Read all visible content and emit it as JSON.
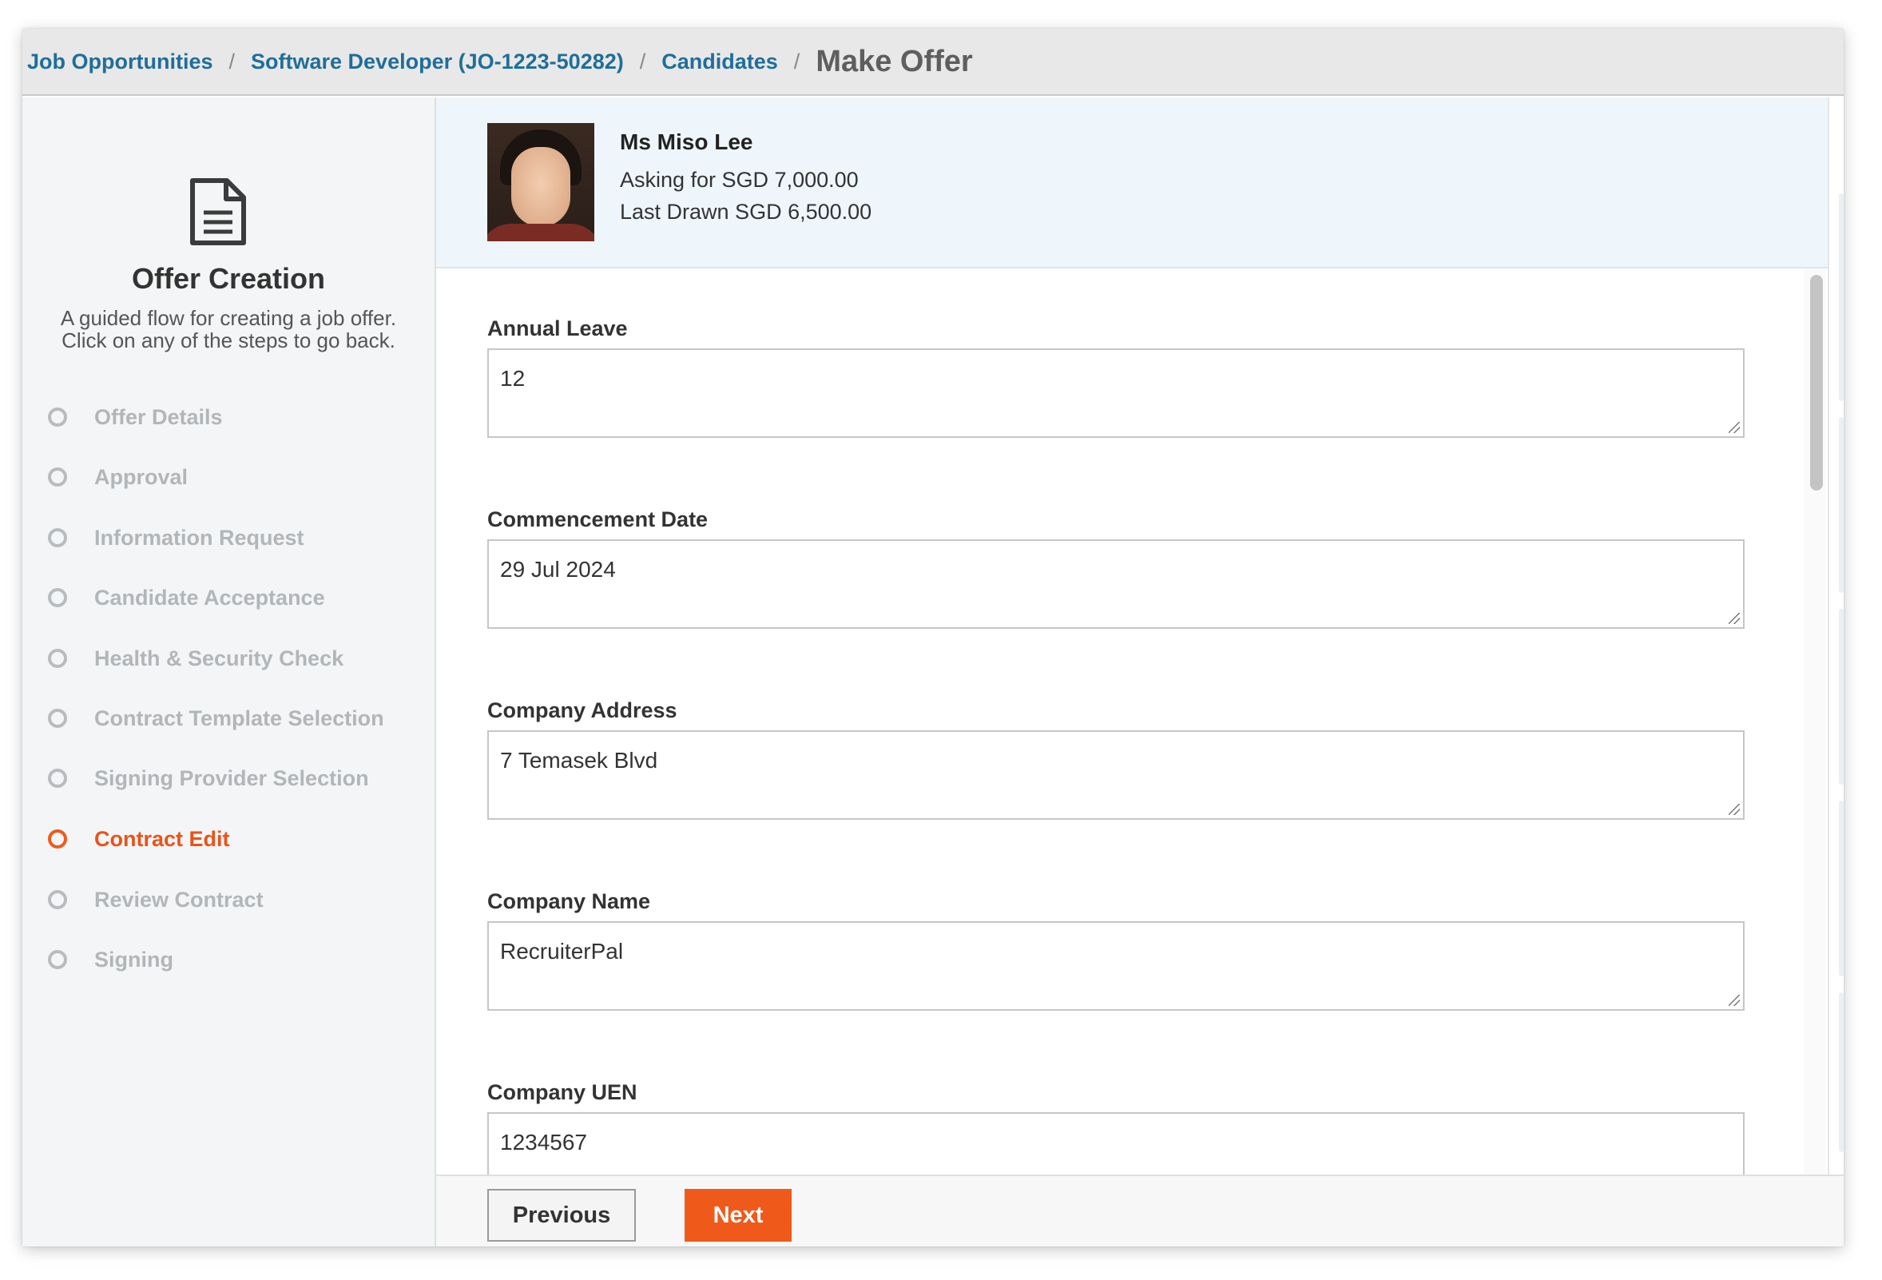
{
  "breadcrumb": {
    "items": [
      "Job Opportunities",
      "Software Developer (JO-1223-50282)",
      "Candidates"
    ],
    "current": "Make Offer",
    "separator": "/"
  },
  "sidebar": {
    "icon": "document-icon",
    "title": "Offer Creation",
    "description": "A guided flow for creating a job offer. Click on any of the steps to go back.",
    "steps": [
      {
        "label": "Offer Details",
        "state": "inactive"
      },
      {
        "label": "Approval",
        "state": "inactive"
      },
      {
        "label": "Information Request",
        "state": "inactive"
      },
      {
        "label": "Candidate Acceptance",
        "state": "inactive"
      },
      {
        "label": "Health & Security Check",
        "state": "inactive"
      },
      {
        "label": "Contract Template Selection",
        "state": "inactive"
      },
      {
        "label": "Signing Provider Selection",
        "state": "inactive"
      },
      {
        "label": "Contract Edit",
        "state": "active"
      },
      {
        "label": "Review Contract",
        "state": "inactive"
      },
      {
        "label": "Signing",
        "state": "inactive"
      }
    ]
  },
  "candidate": {
    "name": "Ms Miso Lee",
    "asking": "Asking for SGD 7,000.00",
    "last_drawn": "Last Drawn SGD 6,500.00"
  },
  "form": {
    "fields": [
      {
        "label": "Annual Leave",
        "value": "12"
      },
      {
        "label": "Commencement Date",
        "value": "29 Jul 2024"
      },
      {
        "label": "Company Address",
        "value": "7 Temasek Blvd"
      },
      {
        "label": "Company Name",
        "value": "RecruiterPal"
      },
      {
        "label": "Company UEN",
        "value": "1234567"
      }
    ]
  },
  "footer": {
    "previous_label": "Previous",
    "next_label": "Next"
  },
  "colors": {
    "accent": "#ef5a1b",
    "link": "#1f6e99",
    "candidate_bg": "#eef6fc"
  }
}
